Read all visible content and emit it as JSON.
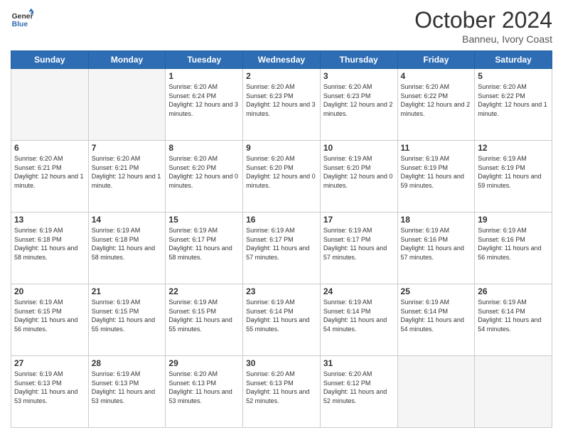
{
  "header": {
    "logo_line1": "General",
    "logo_line2": "Blue",
    "month": "October 2024",
    "location": "Banneu, Ivory Coast"
  },
  "days_of_week": [
    "Sunday",
    "Monday",
    "Tuesday",
    "Wednesday",
    "Thursday",
    "Friday",
    "Saturday"
  ],
  "weeks": [
    [
      {
        "day": "",
        "empty": true
      },
      {
        "day": "",
        "empty": true
      },
      {
        "day": "1",
        "sunrise": "6:20 AM",
        "sunset": "6:24 PM",
        "daylight": "12 hours and 3 minutes."
      },
      {
        "day": "2",
        "sunrise": "6:20 AM",
        "sunset": "6:23 PM",
        "daylight": "12 hours and 3 minutes."
      },
      {
        "day": "3",
        "sunrise": "6:20 AM",
        "sunset": "6:23 PM",
        "daylight": "12 hours and 2 minutes."
      },
      {
        "day": "4",
        "sunrise": "6:20 AM",
        "sunset": "6:22 PM",
        "daylight": "12 hours and 2 minutes."
      },
      {
        "day": "5",
        "sunrise": "6:20 AM",
        "sunset": "6:22 PM",
        "daylight": "12 hours and 1 minute."
      }
    ],
    [
      {
        "day": "6",
        "sunrise": "6:20 AM",
        "sunset": "6:21 PM",
        "daylight": "12 hours and 1 minute."
      },
      {
        "day": "7",
        "sunrise": "6:20 AM",
        "sunset": "6:21 PM",
        "daylight": "12 hours and 1 minute."
      },
      {
        "day": "8",
        "sunrise": "6:20 AM",
        "sunset": "6:20 PM",
        "daylight": "12 hours and 0 minutes."
      },
      {
        "day": "9",
        "sunrise": "6:20 AM",
        "sunset": "6:20 PM",
        "daylight": "12 hours and 0 minutes."
      },
      {
        "day": "10",
        "sunrise": "6:19 AM",
        "sunset": "6:20 PM",
        "daylight": "12 hours and 0 minutes."
      },
      {
        "day": "11",
        "sunrise": "6:19 AM",
        "sunset": "6:19 PM",
        "daylight": "11 hours and 59 minutes."
      },
      {
        "day": "12",
        "sunrise": "6:19 AM",
        "sunset": "6:19 PM",
        "daylight": "11 hours and 59 minutes."
      }
    ],
    [
      {
        "day": "13",
        "sunrise": "6:19 AM",
        "sunset": "6:18 PM",
        "daylight": "11 hours and 58 minutes."
      },
      {
        "day": "14",
        "sunrise": "6:19 AM",
        "sunset": "6:18 PM",
        "daylight": "11 hours and 58 minutes."
      },
      {
        "day": "15",
        "sunrise": "6:19 AM",
        "sunset": "6:17 PM",
        "daylight": "11 hours and 58 minutes."
      },
      {
        "day": "16",
        "sunrise": "6:19 AM",
        "sunset": "6:17 PM",
        "daylight": "11 hours and 57 minutes."
      },
      {
        "day": "17",
        "sunrise": "6:19 AM",
        "sunset": "6:17 PM",
        "daylight": "11 hours and 57 minutes."
      },
      {
        "day": "18",
        "sunrise": "6:19 AM",
        "sunset": "6:16 PM",
        "daylight": "11 hours and 57 minutes."
      },
      {
        "day": "19",
        "sunrise": "6:19 AM",
        "sunset": "6:16 PM",
        "daylight": "11 hours and 56 minutes."
      }
    ],
    [
      {
        "day": "20",
        "sunrise": "6:19 AM",
        "sunset": "6:15 PM",
        "daylight": "11 hours and 56 minutes."
      },
      {
        "day": "21",
        "sunrise": "6:19 AM",
        "sunset": "6:15 PM",
        "daylight": "11 hours and 55 minutes."
      },
      {
        "day": "22",
        "sunrise": "6:19 AM",
        "sunset": "6:15 PM",
        "daylight": "11 hours and 55 minutes."
      },
      {
        "day": "23",
        "sunrise": "6:19 AM",
        "sunset": "6:14 PM",
        "daylight": "11 hours and 55 minutes."
      },
      {
        "day": "24",
        "sunrise": "6:19 AM",
        "sunset": "6:14 PM",
        "daylight": "11 hours and 54 minutes."
      },
      {
        "day": "25",
        "sunrise": "6:19 AM",
        "sunset": "6:14 PM",
        "daylight": "11 hours and 54 minutes."
      },
      {
        "day": "26",
        "sunrise": "6:19 AM",
        "sunset": "6:14 PM",
        "daylight": "11 hours and 54 minutes."
      }
    ],
    [
      {
        "day": "27",
        "sunrise": "6:19 AM",
        "sunset": "6:13 PM",
        "daylight": "11 hours and 53 minutes."
      },
      {
        "day": "28",
        "sunrise": "6:19 AM",
        "sunset": "6:13 PM",
        "daylight": "11 hours and 53 minutes."
      },
      {
        "day": "29",
        "sunrise": "6:20 AM",
        "sunset": "6:13 PM",
        "daylight": "11 hours and 53 minutes."
      },
      {
        "day": "30",
        "sunrise": "6:20 AM",
        "sunset": "6:13 PM",
        "daylight": "11 hours and 52 minutes."
      },
      {
        "day": "31",
        "sunrise": "6:20 AM",
        "sunset": "6:12 PM",
        "daylight": "11 hours and 52 minutes."
      },
      {
        "day": "",
        "empty": true
      },
      {
        "day": "",
        "empty": true
      }
    ]
  ]
}
